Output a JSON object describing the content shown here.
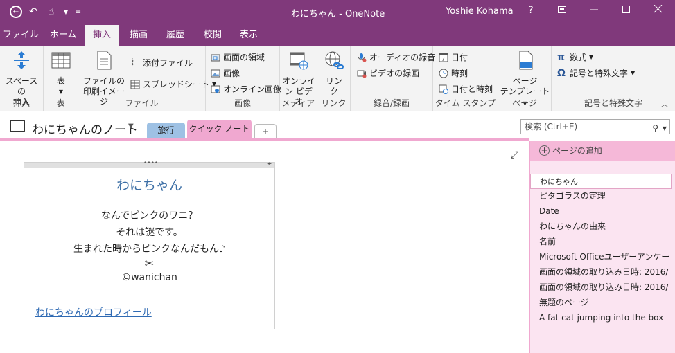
{
  "titlebar": {
    "window_title": "わにちゃん - OneNote",
    "user": "Yoshie Kohama",
    "help": "?",
    "icons": [
      "back-icon",
      "undo-icon",
      "touch-mode-icon",
      "customize-qat-icon",
      "restore-ribbon-icon",
      "minimize-icon",
      "maximize-icon",
      "close-icon"
    ]
  },
  "tabs": [
    "ファイル",
    "ホーム",
    "挿入",
    "描画",
    "履歴",
    "校閲",
    "表示"
  ],
  "ribbon": {
    "groups": {
      "insert": "挿入",
      "table": "表",
      "file": "ファイル",
      "image": "画像",
      "media": "メディア",
      "link": "リンク",
      "record": "録音/録画",
      "timestamp": "タイム スタンプ",
      "page": "ページ",
      "symbols": "記号と特殊文字"
    },
    "space": [
      "スペースの",
      "挿入"
    ],
    "table": "表",
    "printout": [
      "ファイルの",
      "印刷イメージ"
    ],
    "attach": "添付ファイル",
    "spreadsheet": "スプレッドシート",
    "screen_clip": "画面の領域",
    "pictures": "画像",
    "online_pictures": "オンライン画像",
    "online_video": [
      "オンライ",
      "ン ビデオ"
    ],
    "link_btn": [
      "リン",
      "ク"
    ],
    "audio": "オーディオの録音",
    "video": "ビデオの録画",
    "date": "日付",
    "time": "時刻",
    "datetime": "日付と時刻",
    "page_templates": [
      "ページ",
      "テンプレート"
    ],
    "equation": "数式",
    "symbol": "記号と特殊文字"
  },
  "notebook": {
    "name": "わにちゃんのノート",
    "sections": [
      "旅行",
      "クイック ノート"
    ],
    "add_section": "+"
  },
  "search": {
    "placeholder": "検索 (Ctrl+E)"
  },
  "note": {
    "title": "わにちゃん",
    "lines": [
      "なんでピンクのワニ？",
      "それは謎です。",
      "生まれた時からピンクなんだもん♪",
      "✂",
      "©wanichan"
    ],
    "link": "わにちゃんのプロフィール"
  },
  "pages": {
    "add": "ページの追加",
    "items": [
      "わにちゃん",
      "ピタゴラスの定理",
      "Date",
      "わにちゃんの由来",
      "名前",
      "Microsoft Officeユーザーアンケート",
      "画面の領域の取り込み日時: 2016/",
      "画面の領域の取り込み日時: 2016/",
      "無題のページ",
      "A fat cat jumping into the box"
    ]
  },
  "colors": {
    "accent": "#80397b",
    "section_pink": "#f0a8d0",
    "section_blue": "#9ec1e4"
  }
}
